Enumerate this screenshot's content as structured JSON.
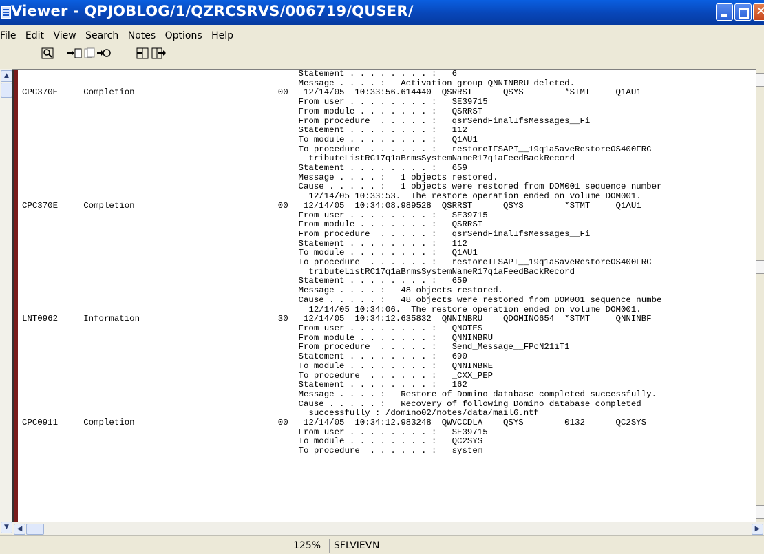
{
  "window": {
    "title": "Viewer - QPJOBLOG/1/QZRCSRVS/006719/QUSER/"
  },
  "menu": [
    "File",
    "Edit",
    "View",
    "Search",
    "Notes",
    "Options",
    "Help"
  ],
  "toolbar": {
    "icons": [
      "zoom-icon",
      "goto-icon",
      "pages-icon",
      "page-nav-icon",
      "split-icon",
      "columns-icon"
    ]
  },
  "log_lines": [
    "                                                      Statement . . . . . . . . :   6",
    "                                                      Message . . . . :   Activation group QNNINBRU deleted.",
    "CPC370E     Completion                            00   12/14/05  10:33:56.614440  QSRRST      QSYS        *STMT     Q1AU1",
    "                                                      From user . . . . . . . . :   SE39715",
    "                                                      From module . . . . . . . :   QSRRST",
    "                                                      From procedure  . . . . . :   qsrSendFinalIfsMessages__Fi",
    "                                                      Statement . . . . . . . . :   112",
    "                                                      To module . . . . . . . . :   Q1AU1",
    "                                                      To procedure  . . . . . . :   restoreIFSAPI__19q1aSaveRestoreOS400FRC",
    "                                                        tributeListRC17q1aBrmsSystemNameR17q1aFeedBackRecord",
    "                                                      Statement . . . . . . . . :   659",
    "                                                      Message . . . . :   1 objects restored.",
    "                                                      Cause . . . . . :   1 objects were restored from DOM001 sequence number",
    "                                                        12/14/05 10:33:53.  The restore operation ended on volume DOM001.",
    "CPC370E     Completion                            00   12/14/05  10:34:08.989528  QSRRST      QSYS        *STMT     Q1AU1",
    "                                                      From user . . . . . . . . :   SE39715",
    "                                                      From module . . . . . . . :   QSRRST",
    "                                                      From procedure  . . . . . :   qsrSendFinalIfsMessages__Fi",
    "                                                      Statement . . . . . . . . :   112",
    "                                                      To module . . . . . . . . :   Q1AU1",
    "                                                      To procedure  . . . . . . :   restoreIFSAPI__19q1aSaveRestoreOS400FRC",
    "                                                        tributeListRC17q1aBrmsSystemNameR17q1aFeedBackRecord",
    "                                                      Statement . . . . . . . . :   659",
    "                                                      Message . . . . :   48 objects restored.",
    "                                                      Cause . . . . . :   48 objects were restored from DOM001 sequence numbe",
    "                                                        12/14/05 10:34:06.  The restore operation ended on volume DOM001.",
    "LNT0962     Information                           30   12/14/05  10:34:12.635832  QNNINBRU    QDOMINO654  *STMT     QNNINBF",
    "                                                      From user . . . . . . . . :   QNOTES",
    "                                                      From module . . . . . . . :   QNNINBRU",
    "                                                      From procedure  . . . . . :   Send_Message__FPcN21iT1",
    "                                                      Statement . . . . . . . . :   690",
    "                                                      To module . . . . . . . . :   QNNINBRE",
    "                                                      To procedure  . . . . . . :   _CXX_PEP",
    "                                                      Statement . . . . . . . . :   162",
    "                                                      Message . . . . :   Restore of Domino database completed successfully.",
    "                                                      Cause . . . . . :   Recovery of following Domino database completed",
    "                                                        successfully : /domino02/notes/data/mail6.ntf",
    "CPC0911     Completion                            00   12/14/05  10:34:12.983248  QWVCCDLA    QSYS        0132      QC2SYS",
    "                                                      From user . . . . . . . . :   SE39715",
    "                                                      To module . . . . . . . . :   QC2SYS",
    "                                                      To procedure  . . . . . . :   system"
  ],
  "status": {
    "zoom": "125%",
    "view": "SFLVIEV",
    "mode": "N"
  }
}
